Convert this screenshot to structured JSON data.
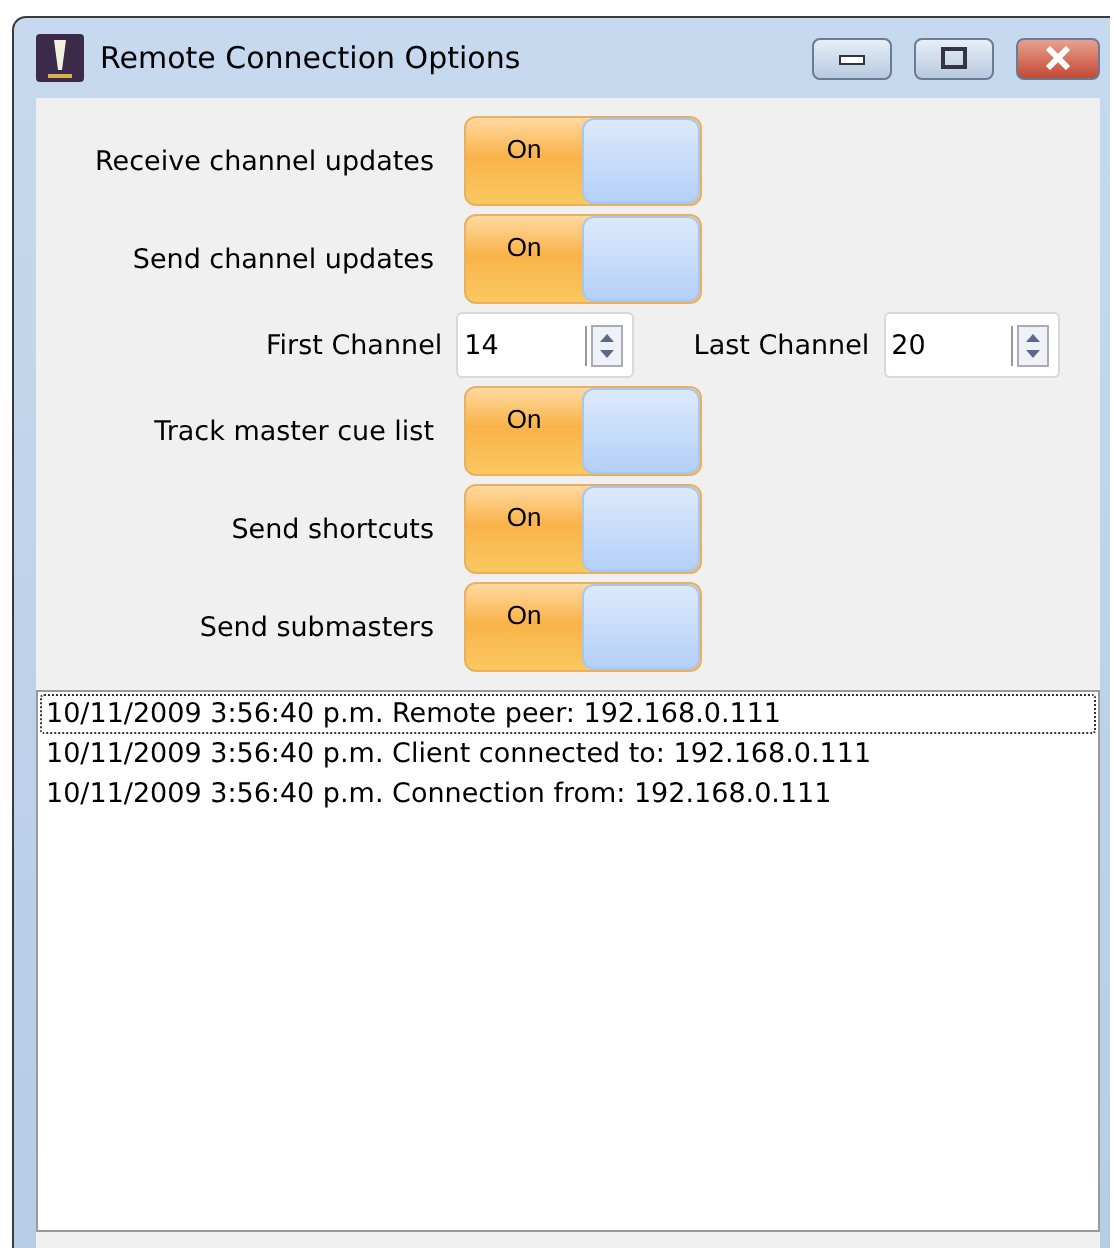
{
  "window": {
    "title": "Remote Connection Options"
  },
  "rows": [
    {
      "kind": "toggle",
      "label": "Receive channel updates",
      "state_text": "On",
      "on": true
    },
    {
      "kind": "toggle",
      "label": "Send channel updates",
      "state_text": "On",
      "on": true
    },
    {
      "kind": "spins",
      "fields": [
        {
          "label": "First Channel",
          "value": "14"
        },
        {
          "label": "Last Channel",
          "value": "20"
        }
      ]
    },
    {
      "kind": "toggle",
      "label": "Track master cue list",
      "state_text": "On",
      "on": true
    },
    {
      "kind": "toggle",
      "label": "Send shortcuts",
      "state_text": "On",
      "on": true
    },
    {
      "kind": "toggle",
      "label": "Send submasters",
      "state_text": "On",
      "on": true
    }
  ],
  "log": [
    {
      "text": "10/11/2009 3:56:40 p.m. Remote peer: 192.168.0.111",
      "selected": true
    },
    {
      "text": "10/11/2009 3:56:40 p.m. Client connected to: 192.168.0.111",
      "selected": false
    },
    {
      "text": "10/11/2009 3:56:40 p.m. Connection from: 192.168.0.111",
      "selected": false
    }
  ]
}
